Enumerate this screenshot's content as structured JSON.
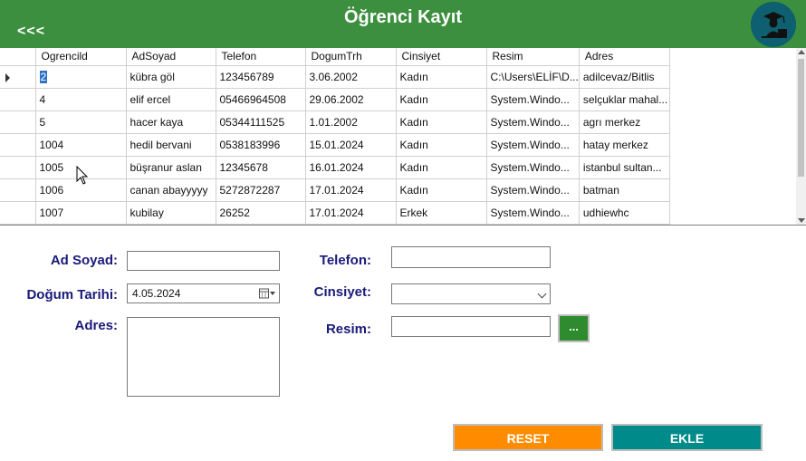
{
  "header": {
    "title": "Öğrenci Kayıt",
    "back_label": "<<<",
    "accent_color": "#3c8f3e"
  },
  "grid": {
    "columns": [
      "Ogrencild",
      "AdSoyad",
      "Telefon",
      "DogumTrh",
      "Cinsiyet",
      "Resim",
      "Adres"
    ],
    "rows": [
      [
        "2",
        "kübra göl",
        "123456789",
        "3.06.2002",
        "Kadın",
        "C:\\Users\\ELİF\\D...",
        "adilcevaz/Bitlis"
      ],
      [
        "4",
        "elif ercel",
        "05466964508",
        "29.06.2002",
        "Kadın",
        "System.Windo...",
        "selçuklar mahal..."
      ],
      [
        "5",
        "hacer kaya",
        "05344111525",
        "1.01.2002",
        "Kadın",
        "System.Windo...",
        "agrı merkez"
      ],
      [
        "1004",
        "hedil bervani",
        "0538183996",
        "15.01.2024",
        "Kadın",
        "System.Windo...",
        "hatay merkez"
      ],
      [
        "1005",
        "büşranur aslan",
        "12345678",
        "16.01.2024",
        "Kadın",
        "System.Windo...",
        "istanbul sultan..."
      ],
      [
        "1006",
        "canan abayyyyy",
        "5272872287",
        "17.01.2024",
        "Kadın",
        "System.Windo...",
        "batman"
      ],
      [
        "1007",
        "kubilay",
        "26252",
        "17.01.2024",
        "Erkek",
        "System.Windo...",
        "udhiewhc"
      ]
    ],
    "selected_row": 0
  },
  "form": {
    "adsoyad_label": "Ad Soyad:",
    "adsoyad_value": "",
    "dogum_label": "Doğum Tarihi:",
    "dogum_value": "4.05.2024",
    "adres_label": "Adres:",
    "adres_value": "",
    "telefon_label": "Telefon:",
    "telefon_value": "",
    "cinsiyet_label": "Cinsiyet:",
    "cinsiyet_value": "",
    "resim_label": "Resim:",
    "resim_value": "",
    "browse_label": "..."
  },
  "buttons": {
    "reset_label": "RESET",
    "reset_color": "#ff8c00",
    "ekle_label": "EKLE",
    "ekle_color": "#008b8b"
  }
}
